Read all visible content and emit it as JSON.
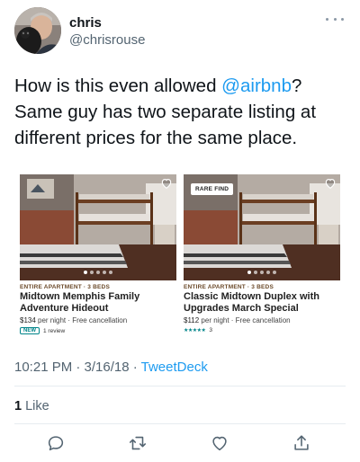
{
  "user": {
    "name": "chris",
    "handle": "@chrisrouse",
    "avatar_icon": "user-avatar"
  },
  "tweet": {
    "text_before": "How is this even allowed ",
    "mention": "@airbnb",
    "text_after": "? Same guy has two separate listing at different prices for the same place."
  },
  "listings": [
    {
      "badge": "",
      "type": "ENTIRE APARTMENT · 3 BEDS",
      "title": "Midtown Memphis Family Adventure Hideout",
      "price": "$134",
      "price_suffix": " per night · Free cancellation",
      "tag": "NEW",
      "rating_text": "1 review"
    },
    {
      "badge": "RARE FIND",
      "type": "ENTIRE APARTMENT · 3 BEDS",
      "title": "Classic Midtown Duplex with Upgrades March Special",
      "price": "$112",
      "price_suffix": " per night · Free cancellation",
      "stars": "★★★★★",
      "rating_text": "3"
    }
  ],
  "meta": {
    "time": "10:21 PM · 3/16/18 · ",
    "source": "TweetDeck"
  },
  "engagement": {
    "like_count": "1",
    "like_label": " Like"
  },
  "colors": {
    "link": "#1d9bf0",
    "airbnb_teal": "#008489",
    "muted": "#536471"
  }
}
